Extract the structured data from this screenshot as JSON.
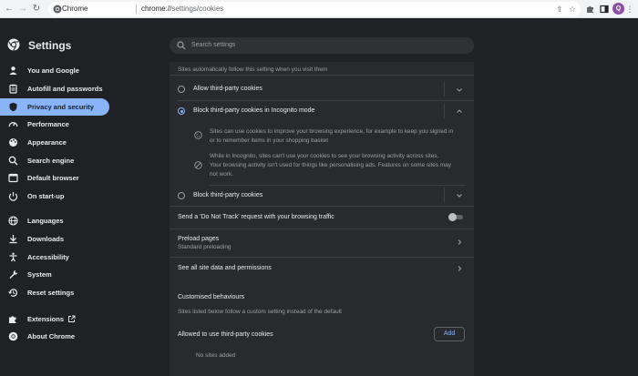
{
  "browser": {
    "tab_label": "Chrome",
    "url_host": "chrome://",
    "url_path": "settings/cookies",
    "profile_initial": "Q"
  },
  "header": {
    "title": "Settings",
    "search_placeholder": "Search settings"
  },
  "sidebar": {
    "items": [
      {
        "label": "You and Google",
        "icon": "person-icon"
      },
      {
        "label": "Autofill and passwords",
        "icon": "clipboard-icon"
      },
      {
        "label": "Privacy and security",
        "icon": "shield-icon",
        "active": true
      },
      {
        "label": "Performance",
        "icon": "speedometer-icon"
      },
      {
        "label": "Appearance",
        "icon": "palette-icon"
      },
      {
        "label": "Search engine",
        "icon": "search-icon"
      },
      {
        "label": "Default browser",
        "icon": "browser-icon"
      },
      {
        "label": "On start-up",
        "icon": "power-icon"
      },
      {
        "label": "Languages",
        "icon": "globe-icon"
      },
      {
        "label": "Downloads",
        "icon": "download-icon"
      },
      {
        "label": "Accessibility",
        "icon": "accessibility-icon"
      },
      {
        "label": "System",
        "icon": "wrench-icon"
      },
      {
        "label": "Reset settings",
        "icon": "history-icon"
      },
      {
        "label": "Extensions",
        "icon": "puzzle-icon"
      },
      {
        "label": "About Chrome",
        "icon": "chrome-icon"
      }
    ]
  },
  "main": {
    "intro": "Sites automatically follow this setting when you visit them",
    "options": [
      {
        "label": "Allow third-party cookies",
        "checked": false
      },
      {
        "label": "Block third-party cookies in Incognito mode",
        "checked": true
      },
      {
        "label": "Block third-party cookies",
        "checked": false
      }
    ],
    "details": [
      {
        "line1": "Sites can use cookies to improve your browsing experience, for example to keep you signed in",
        "line2": "or to remember items in your shopping basket"
      },
      {
        "line1": "While in Incognito, sites can't use your cookies to see your browsing activity across sites.",
        "line2": "Your browsing activity isn't used for things like personalising ads. Features on some sites may",
        "line3": "not work."
      }
    ],
    "dnt_label": "Send a 'Do Not Track' request with your browsing traffic",
    "preload_label": "Preload pages",
    "preload_value": "Standard preloading",
    "see_all_label": "See all site data and permissions",
    "custom_heading": "Customised behaviours",
    "custom_desc": "Sites listed below follow a custom setting instead of the default",
    "allowed_label": "Allowed to use third-party cookies",
    "add_label": "Add",
    "empty_label": "No sites added"
  }
}
